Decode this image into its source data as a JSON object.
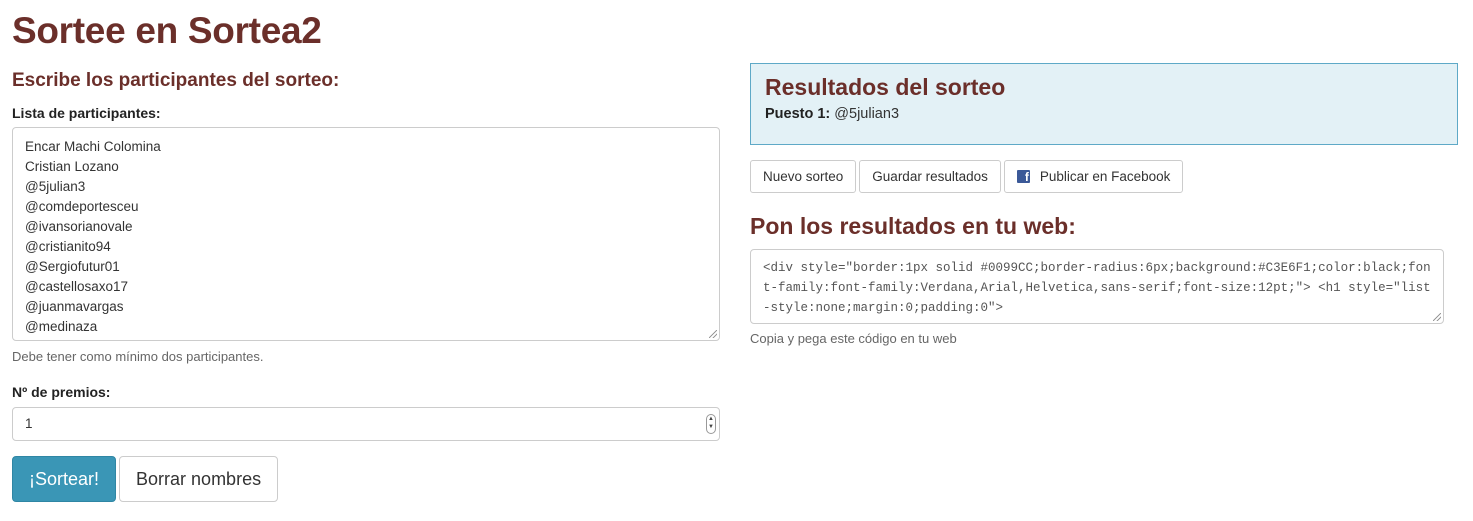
{
  "page": {
    "title": "Sortee en Sortea2"
  },
  "form": {
    "heading": "Escribe los participantes del sorteo:",
    "participants_label": "Lista de participantes:",
    "participants": [
      "Encar Machi Colomina",
      "Cristian Lozano",
      "@5julian3",
      "@comdeportesceu",
      "@ivansorianovale",
      "@cristianito94",
      "@Sergiofutur01",
      "@castellosaxo17",
      "@juanmavargas",
      "@medinaza"
    ],
    "participants_help": "Debe tener como mínimo dos participantes.",
    "prizes_label": "Nº de premios:",
    "prizes_value": "1",
    "draw_button": "¡Sortear!",
    "clear_button": "Borrar nombres"
  },
  "results": {
    "title": "Resultados del sorteo",
    "position_label": "Puesto 1:",
    "winner": "@5julian3",
    "new_draw_button": "Nuevo sorteo",
    "save_button": "Guardar resultados",
    "facebook_button": "Publicar en Facebook"
  },
  "embed": {
    "heading": "Pon los resultados en tu web:",
    "code": "<div style=\"border:1px solid #0099CC;border-radius:6px;background:#C3E6F1;color:black;font-family:font-family:Verdana,Arial,Helvetica,sans-serif;font-size:12pt;\"> <h1 style=\"list-style:none;margin:0;padding:0\">",
    "help": "Copia y pega este código en tu web"
  },
  "colors": {
    "heading": "#6b2f2a",
    "primary_button": "#3a96b6",
    "results_panel_bg": "#e3f1f6",
    "results_panel_border": "#5ea9c7",
    "facebook": "#3b5998"
  },
  "icons": {
    "facebook": "facebook-icon"
  }
}
